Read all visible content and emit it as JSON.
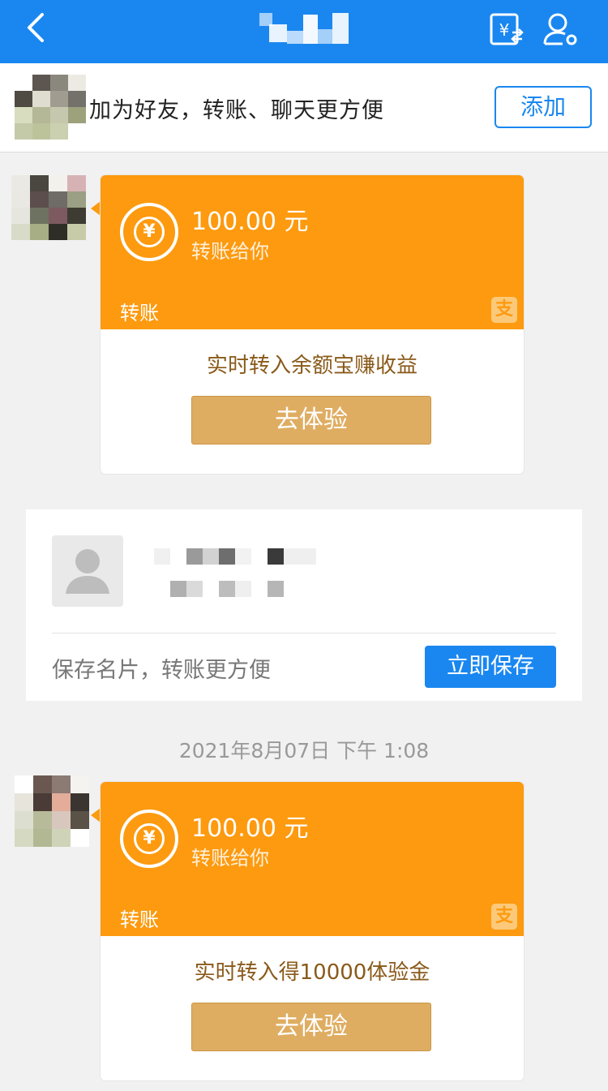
{
  "navbar": {
    "back_icon": "chevron-left-icon",
    "transfer_icon": "yuan-transfer-icon",
    "profile_icon": "person-settings-icon",
    "color": "#1a87f0"
  },
  "banner": {
    "text": "加为好友，转账、聊天更方便",
    "add_label": "添加"
  },
  "messages": [
    {
      "amount": "100.00 元",
      "subtitle": "转账给你",
      "label": "转账",
      "brand_icon": "支",
      "promo": "实时转入余额宝赚收益",
      "button": "去体验"
    },
    {
      "amount": "100.00 元",
      "subtitle": "转账给你",
      "label": "转账",
      "brand_icon": "支",
      "promo": "实时转入得10000体验金",
      "button": "去体验"
    }
  ],
  "contact_card": {
    "hint": "保存名片，转账更方便",
    "save_label": "立即保存"
  },
  "timestamp": "2021年8月07日 下午 1:08",
  "colors": {
    "orange": "#fd9a0f",
    "gold_button": "#dfad62",
    "blue": "#1a87f0"
  }
}
